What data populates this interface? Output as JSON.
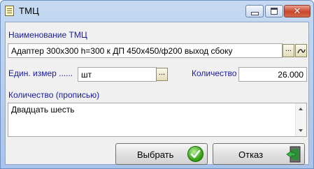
{
  "window": {
    "title": "ТМЦ"
  },
  "form": {
    "name_label": "Наименование ТМЦ",
    "name_value": "Адаптер 300х300 h=300 к ДП 450х450/ф200 выход сбоку",
    "ellipsis": "...",
    "unit_label": "Един. измер ......",
    "unit_value": "шт",
    "quantity_label": "Количество",
    "quantity_value": "26.000",
    "quantity_words_label": "Количество (прописью)",
    "quantity_words_value": "Двадцать шесть"
  },
  "buttons": {
    "select_label": "Выбрать",
    "cancel_label": "Отказ"
  },
  "icons": {
    "window_icon": "notepad-icon",
    "clear_field": "eraser-icon",
    "select": "checkmark-icon",
    "cancel": "exit-door-icon"
  },
  "colors": {
    "label_blue": "#1a1a9c",
    "close_red": "#c8452a",
    "ok_green": "#3aa416"
  }
}
